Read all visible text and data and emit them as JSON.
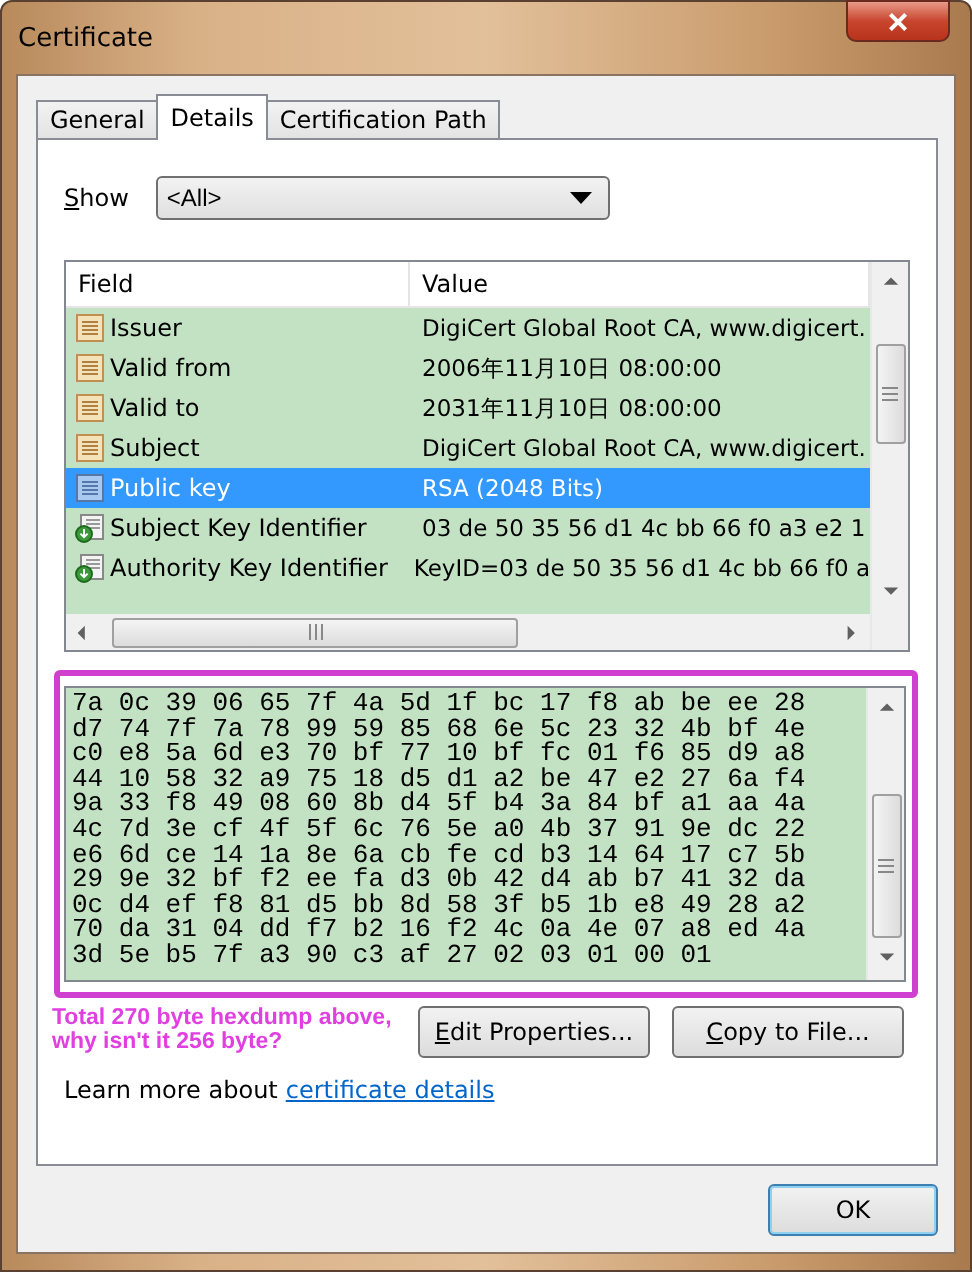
{
  "window": {
    "title": "Certificate",
    "close": "×"
  },
  "tabs": [
    {
      "label": "General",
      "selected": false
    },
    {
      "label": "Details",
      "selected": true
    },
    {
      "label": "Certification Path",
      "selected": false
    }
  ],
  "show": {
    "label": "Show",
    "underline_first": true,
    "value": "<All>"
  },
  "fields_table": {
    "columns": [
      "Field",
      "Value"
    ],
    "rows": [
      {
        "kind": "property",
        "field": "Issuer",
        "value": "DigiCert Global Root CA, www.digicert.",
        "selected": false
      },
      {
        "kind": "property",
        "field": "Valid from",
        "value": "2006年11月10日 08:00:00",
        "selected": false
      },
      {
        "kind": "property",
        "field": "Valid to",
        "value": "2031年11月10日 08:00:00",
        "selected": false
      },
      {
        "kind": "property",
        "field": "Subject",
        "value": "DigiCert Global Root CA, www.digicert.",
        "selected": false
      },
      {
        "kind": "property",
        "field": "Public key",
        "value": "RSA (2048 Bits)",
        "selected": true
      },
      {
        "kind": "extension",
        "field": "Subject Key Identifier",
        "value": "03 de 50 35 56 d1 4c bb 66 f0 a3 e2 1",
        "selected": false
      },
      {
        "kind": "extension",
        "field": "Authority Key Identifier",
        "value": "KeyID=03 de 50 35 56 d1 4c bb 66 f0 a",
        "selected": false
      }
    ]
  },
  "hex_dump": [
    "7a 0c 39 06 65 7f 4a 5d 1f bc 17 f8 ab be ee 28",
    "d7 74 7f 7a 78 99 59 85 68 6e 5c 23 32 4b bf 4e",
    "c0 e8 5a 6d e3 70 bf 77 10 bf fc 01 f6 85 d9 a8",
    "44 10 58 32 a9 75 18 d5 d1 a2 be 47 e2 27 6a f4",
    "9a 33 f8 49 08 60 8b d4 5f b4 3a 84 bf a1 aa 4a",
    "4c 7d 3e cf 4f 5f 6c 76 5e a0 4b 37 91 9e dc 22",
    "e6 6d ce 14 1a 8e 6a cb fe cd b3 14 64 17 c7 5b",
    "29 9e 32 bf f2 ee fa d3 0b 42 d4 ab b7 41 32 da",
    "0c d4 ef f8 81 d5 bb 8d 58 3f b5 1b e8 49 28 a2",
    "70 da 31 04 dd f7 b2 16 f2 4c 0a 4e 07 a8 ed 4a",
    "3d 5e b5 7f a3 90 c3 af 27 02 03 01 00 01"
  ],
  "annotation": "Total 270 byte hexdump above,\nwhy isn't it 256 byte?",
  "buttons": [
    {
      "label": "Edit Properties...",
      "underline_first": true
    },
    {
      "label": "Copy to File...",
      "underline_first": true
    }
  ],
  "learn_more": {
    "text": "Learn more about",
    "link": "certificate details"
  },
  "ok_button": "OK"
}
